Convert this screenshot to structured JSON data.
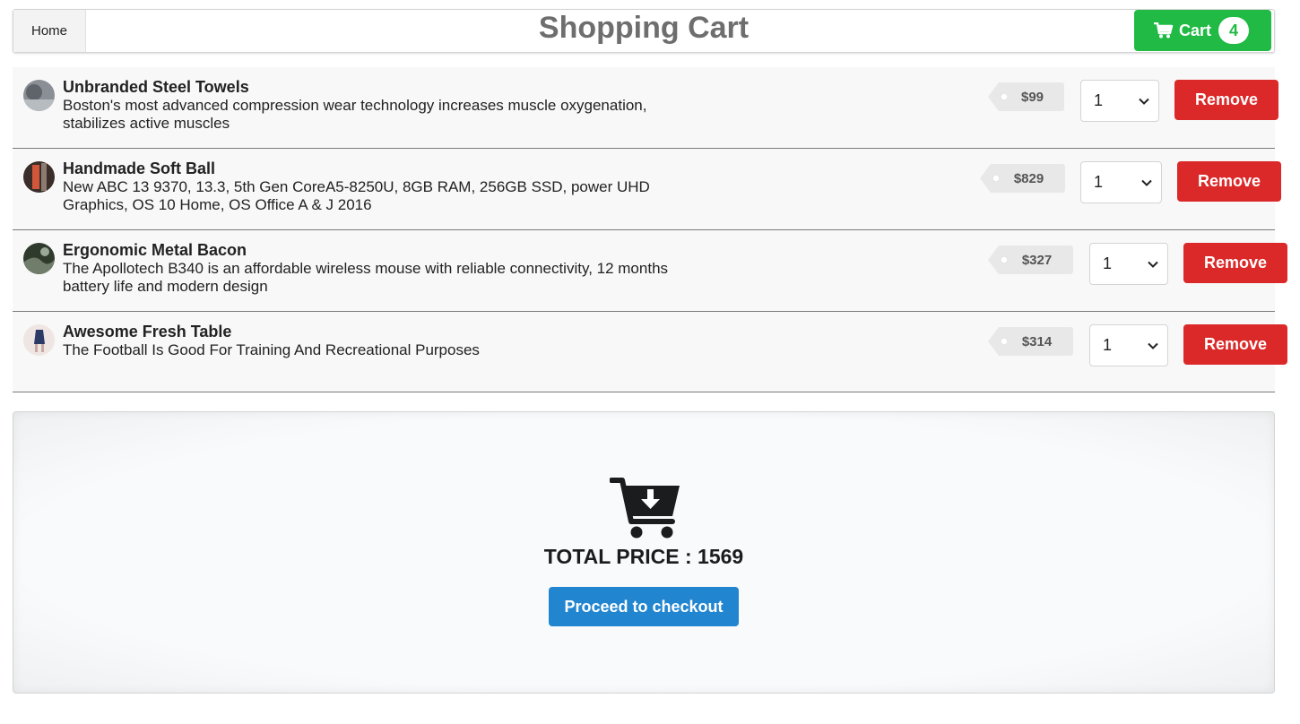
{
  "nav": {
    "home_label": "Home",
    "title": "Shopping Cart",
    "cart_label": "Cart",
    "cart_count": "4",
    "cart_color": "#21ba45"
  },
  "items": [
    {
      "name": "Unbranded Steel Towels",
      "description": "Boston's most advanced compression wear technology increases muscle oxygenation, stabilizes active muscles",
      "price": "$99",
      "quantity": "1",
      "remove_label": "Remove",
      "avatar_icon": "product-thumbnail-icon"
    },
    {
      "name": "Handmade Soft Ball",
      "description": "New ABC 13 9370, 13.3, 5th Gen CoreA5-8250U, 8GB RAM, 256GB SSD, power UHD Graphics, OS 10 Home, OS Office A & J 2016",
      "price": "$829",
      "quantity": "1",
      "remove_label": "Remove",
      "avatar_icon": "product-thumbnail-icon"
    },
    {
      "name": "Ergonomic Metal Bacon",
      "description": "The Apollotech B340 is an affordable wireless mouse with reliable connectivity, 12 months battery life and modern design",
      "price": "$327",
      "quantity": "1",
      "remove_label": "Remove",
      "avatar_icon": "product-thumbnail-icon"
    },
    {
      "name": "Awesome Fresh Table",
      "description": "The Football Is Good For Training And Recreational Purposes",
      "price": "$314",
      "quantity": "1",
      "remove_label": "Remove",
      "avatar_icon": "product-thumbnail-icon"
    }
  ],
  "summary": {
    "icon": "cart-download-icon",
    "total_text": "TOTAL PRICE : 1569",
    "checkout_label": "Proceed to checkout",
    "checkout_color": "#2185d0",
    "remove_color": "#db2828"
  }
}
